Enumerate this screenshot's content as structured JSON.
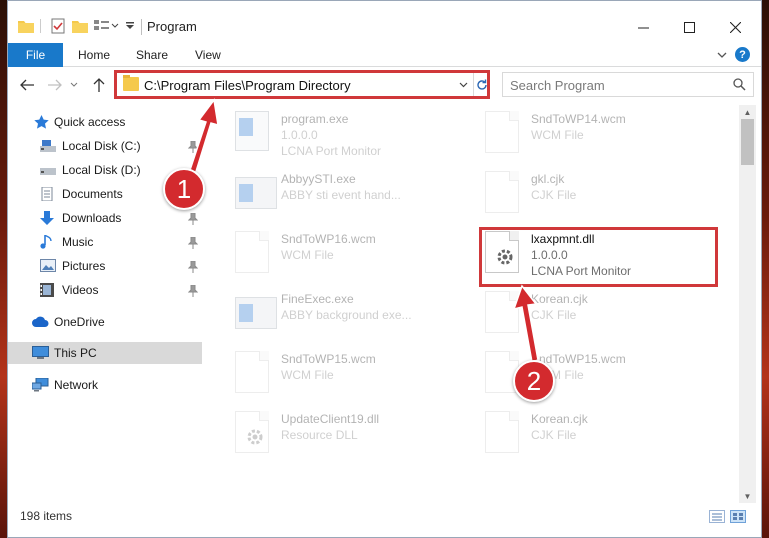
{
  "window": {
    "title": "Program",
    "quick_access_icons": [
      "folder-icon",
      "properties-icon",
      "new-folder-icon",
      "customize-icon"
    ]
  },
  "ribbon": {
    "tabs": [
      "File",
      "Home",
      "Share",
      "View"
    ],
    "help_label": "?"
  },
  "navigation": {
    "address": "C:\\Program Files\\Program Directory",
    "search_placeholder": "Search Program"
  },
  "sidebar": {
    "items": [
      {
        "label": "Quick access",
        "icon": "star-icon",
        "pinned": false
      },
      {
        "label": "Local Disk (C:)",
        "icon": "drive-icon",
        "pinned": true
      },
      {
        "label": "Local Disk (D:)",
        "icon": "drive-icon",
        "pinned": false
      },
      {
        "label": "Documents",
        "icon": "documents-icon",
        "pinned": true
      },
      {
        "label": "Downloads",
        "icon": "download-icon",
        "pinned": true
      },
      {
        "label": "Music",
        "icon": "music-icon",
        "pinned": true
      },
      {
        "label": "Pictures",
        "icon": "pictures-icon",
        "pinned": true
      },
      {
        "label": "Videos",
        "icon": "videos-icon",
        "pinned": true
      },
      {
        "label": "OneDrive",
        "icon": "cloud-icon",
        "pinned": false
      },
      {
        "label": "This PC",
        "icon": "computer-icon",
        "pinned": false,
        "selected": true
      },
      {
        "label": "Network",
        "icon": "network-icon",
        "pinned": false
      }
    ]
  },
  "files": {
    "left": [
      {
        "name": "program.exe",
        "line2": "1.0.0.0",
        "line3": "LCNA Port Monitor",
        "icon": "installer-icon"
      },
      {
        "name": "AbbyySTI.exe",
        "line2": "ABBY sti event hand...",
        "line3": "",
        "icon": "exe-icon"
      },
      {
        "name": "SndToWP16.wcm",
        "line2": "WCM File",
        "line3": "",
        "icon": "file-icon"
      },
      {
        "name": "FineExec.exe",
        "line2": "ABBY background exe...",
        "line3": "",
        "icon": "exe-icon"
      },
      {
        "name": "SndToWP15.wcm",
        "line2": "WCM File",
        "line3": "",
        "icon": "file-icon"
      },
      {
        "name": "UpdateClient19.dll",
        "line2": "Resource DLL",
        "line3": "",
        "icon": "dll-icon"
      }
    ],
    "right": [
      {
        "name": "SndToWP14.wcm",
        "line2": "WCM File",
        "line3": "",
        "icon": "file-icon"
      },
      {
        "name": "gkl.cjk",
        "line2": "CJK File",
        "line3": "",
        "icon": "file-icon"
      },
      {
        "name": "lxaxpmnt.dll",
        "line2": "1.0.0.0",
        "line3": "LCNA Port Monitor",
        "icon": "dll-icon",
        "highlighted": true
      },
      {
        "name": "Korean.cjk",
        "line2": "CJK File",
        "line3": "",
        "icon": "file-icon"
      },
      {
        "name": "SndToWP15.wcm",
        "line2": "WCM File",
        "line3": "",
        "icon": "file-icon"
      },
      {
        "name": "Korean.cjk",
        "line2": "CJK File",
        "line3": "",
        "icon": "file-icon"
      }
    ]
  },
  "status": {
    "item_count": "198 items"
  },
  "annotations": {
    "step1": "1",
    "step2": "2",
    "color": "#d32a2e"
  }
}
